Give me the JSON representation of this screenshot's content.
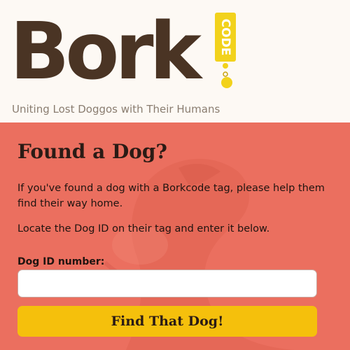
{
  "header": {
    "logo_text": "Bork",
    "logo_tag_text": "CODE",
    "tagline": "Uniting Lost Doggos with Their Humans"
  },
  "main": {
    "title": "Found a Dog?",
    "paragraph1": "If you've found a dog with a Borkcode tag, please help them find their way home.",
    "paragraph2": "Locate the Dog ID on their tag and enter it below.",
    "dog_id_label": "Dog ID number:",
    "dog_id_value": "",
    "dog_id_placeholder": "",
    "submit_label": "Find That Dog!"
  },
  "colors": {
    "accent": "#eb6f5f",
    "brand": "#4a3424",
    "button": "#f5c00c"
  }
}
